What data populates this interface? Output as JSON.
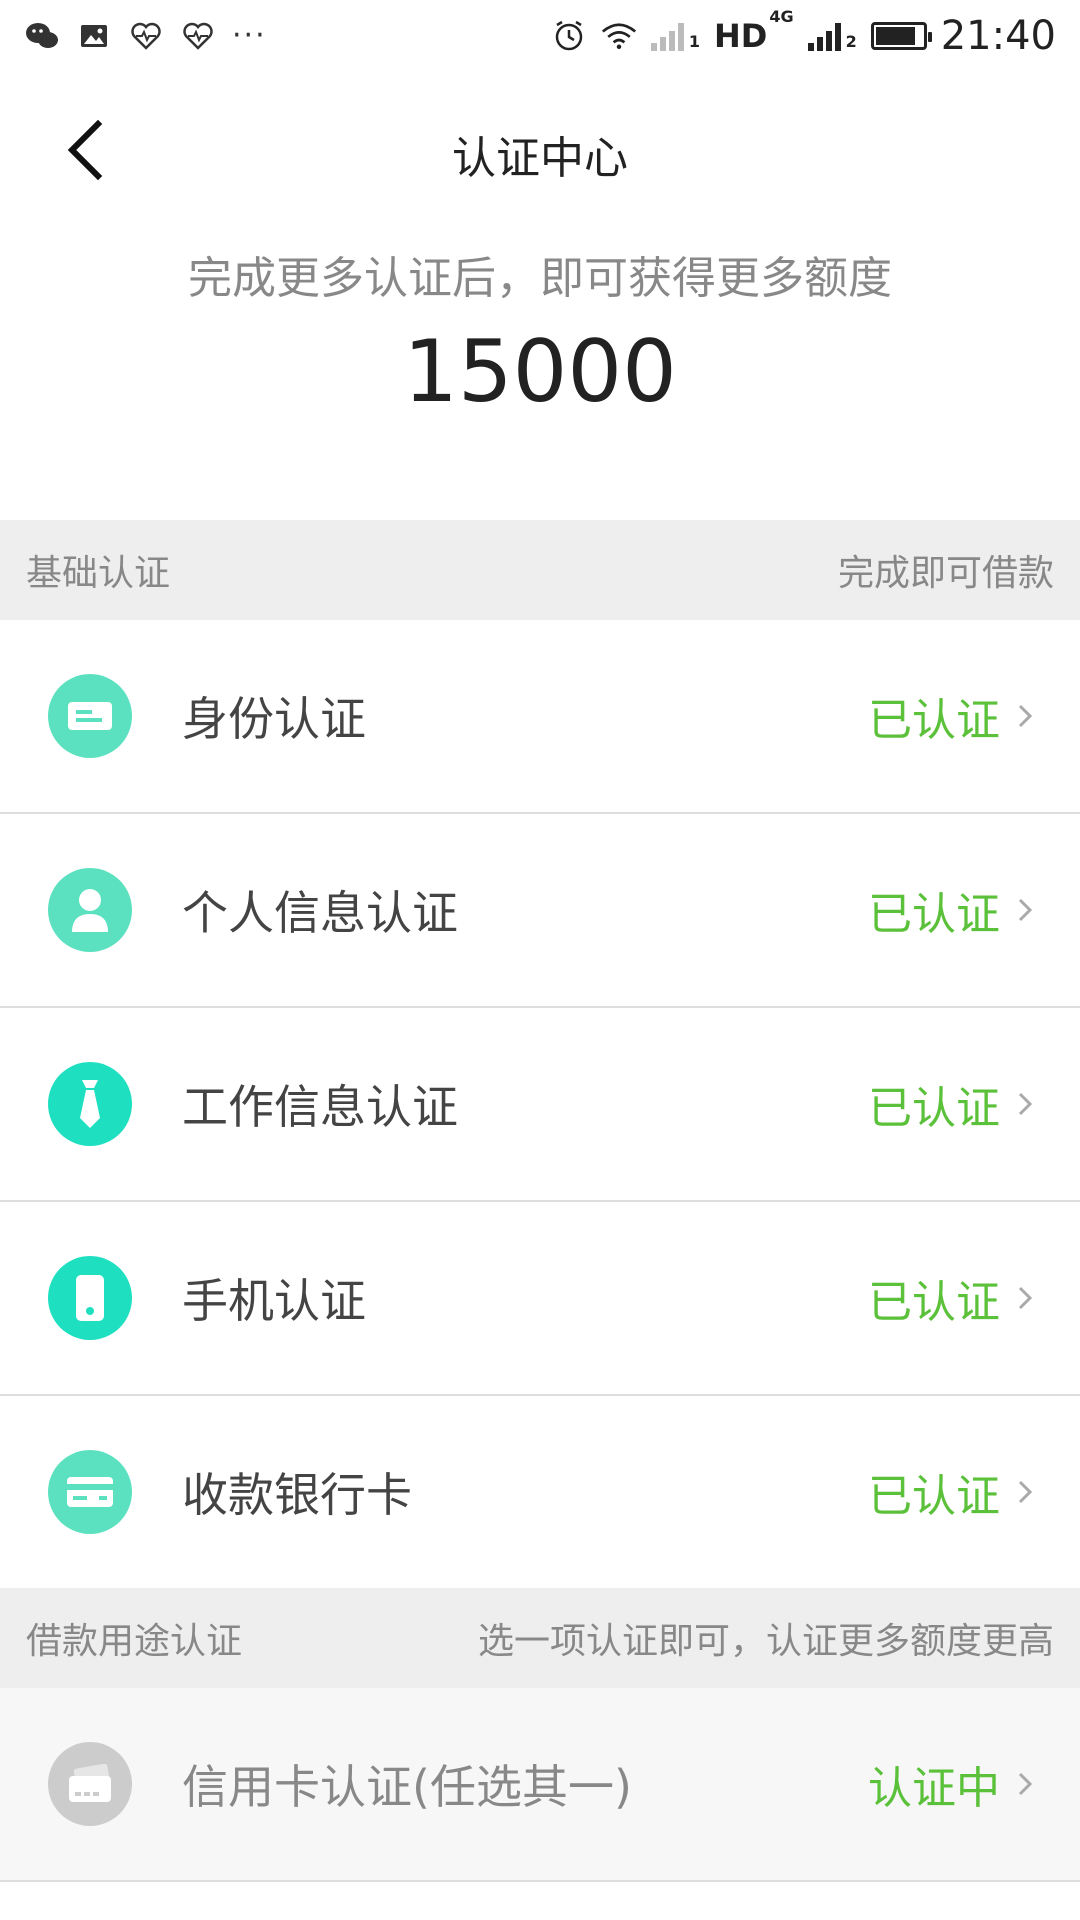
{
  "status_bar": {
    "network": "HD",
    "network_sup": "4G",
    "time": "21:40",
    "battery_level": 0.85,
    "icons": [
      "wechat-icon",
      "image-icon",
      "heart-rate-icon",
      "heart-rate-icon",
      "more-dots-icon",
      "alarm-icon",
      "wifi-icon",
      "signal-sim1-icon",
      "signal-sim2-icon",
      "battery-icon"
    ],
    "sim1_label": "1",
    "sim2_label": "2",
    "dots": "···"
  },
  "navbar": {
    "title": "认证中心",
    "back_icon": "chevron-left-icon"
  },
  "hero": {
    "subtitle": "完成更多认证后，即可获得更多额度",
    "amount": "15000"
  },
  "basic_section": {
    "title": "基础认证",
    "note": "完成即可借款",
    "items": [
      {
        "label": "身份认证",
        "status": "已认证",
        "icon": "id-card-icon",
        "icon_color": "#5ce1c0"
      },
      {
        "label": "个人信息认证",
        "status": "已认证",
        "icon": "person-icon",
        "icon_color": "#5ce1c0"
      },
      {
        "label": "工作信息认证",
        "status": "已认证",
        "icon": "tie-icon",
        "icon_color": "#1ee0c0"
      },
      {
        "label": "手机认证",
        "status": "已认证",
        "icon": "phone-icon",
        "icon_color": "#1ee0c0"
      },
      {
        "label": "收款银行卡",
        "status": "已认证",
        "icon": "bank-card-icon",
        "icon_color": "#5ce1c0"
      }
    ]
  },
  "purpose_section": {
    "title": "借款用途认证",
    "note": "选一项认证即可，认证更多额度更高",
    "items": [
      {
        "label": "信用卡认证(任选其一)",
        "status": "认证中",
        "icon": "credit-card-icon",
        "icon_color": "#cccccc"
      }
    ]
  },
  "colors": {
    "accent_green": "#5cc13a",
    "teal_light": "#5ce1c0",
    "teal": "#1ee0c0",
    "section_bg": "#eeeeee",
    "muted_text": "#888888"
  }
}
